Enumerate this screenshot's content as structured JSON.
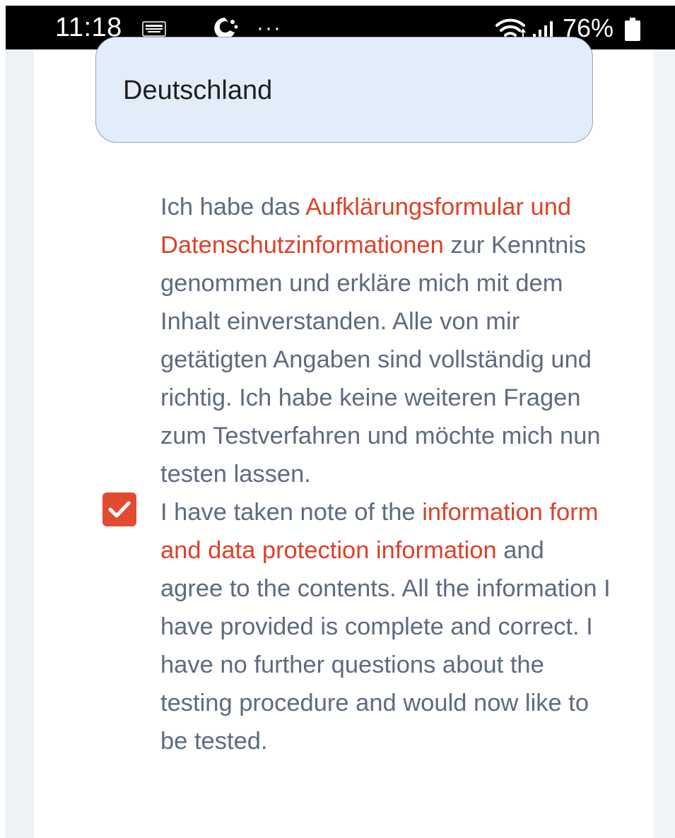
{
  "status_bar": {
    "time": "11:18",
    "more": "···",
    "battery": "76%",
    "icons": [
      "notification-icon",
      "app-icon",
      "wifi-icon",
      "signal-icon",
      "battery-icon"
    ]
  },
  "form": {
    "country_value": "Deutschland",
    "consent_checked": true,
    "consent_de": {
      "pre": "Ich habe das ",
      "link": "Aufklärungsformular und Datenschutzinformationen",
      "post": " zur Kenntnis genommen und erkläre mich mit dem Inhalt einverstanden. Alle von mir getätigten Angaben sind vollständig und richtig. Ich habe keine weiteren Fragen zum Testverfahren und möchte mich nun testen lassen."
    },
    "consent_en": {
      "pre": "I have taken note of the ",
      "link": "information form and data protection information",
      "post": " and agree to the contents. All the information I have provided is complete and correct. I have no further questions about the testing procedure and would now like to be tested."
    }
  },
  "colors": {
    "accent": "#de4127",
    "checkbox": "#e14b32",
    "body_text": "#5e6a80",
    "field_bg": "#e3edf9",
    "field_border": "#8fa2bf"
  }
}
